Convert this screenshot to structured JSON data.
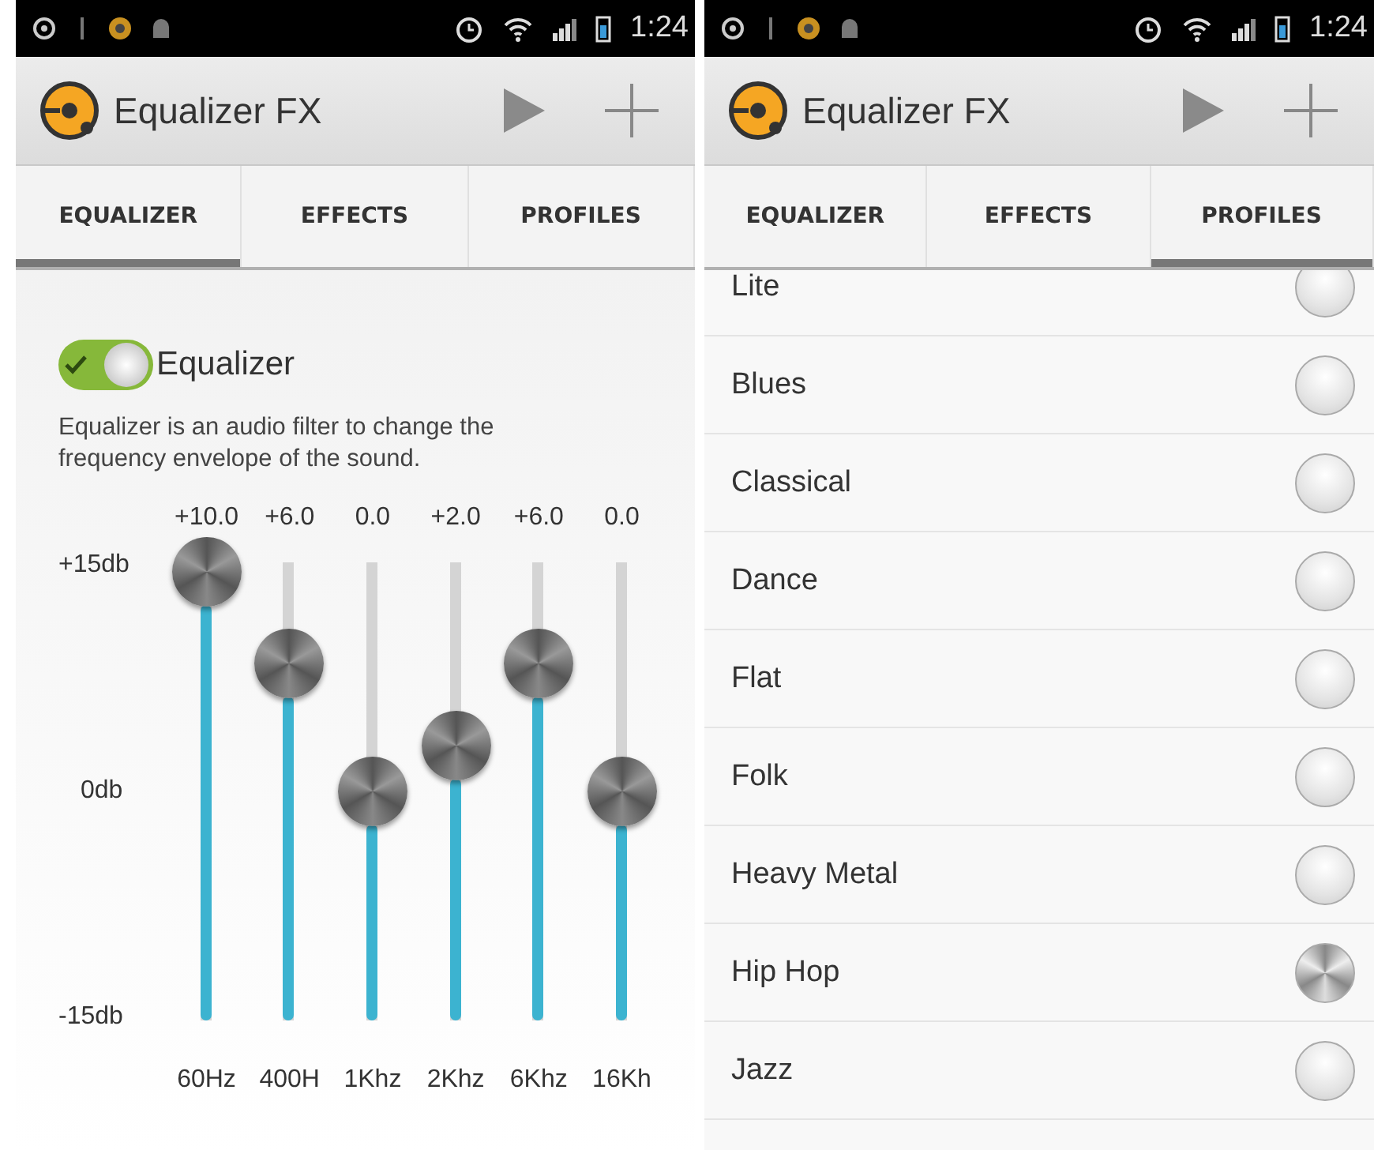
{
  "screens": [
    {
      "status_bar": {
        "time": "1:24"
      },
      "app_bar": {
        "title": "Equalizer FX"
      },
      "tabs": [
        {
          "label": "EQUALIZER",
          "selected": true
        },
        {
          "label": "EFFECTS",
          "selected": false
        },
        {
          "label": "PROFILES",
          "selected": false
        }
      ],
      "content": {
        "kind": "equalizer",
        "toggle": {
          "label": "Equalizer",
          "on": true
        },
        "description": "Equalizer is an audio filter to change the frequency envelope of the sound.",
        "scale": [
          "+15db",
          "0db",
          "-15db"
        ],
        "bands": [
          {
            "value": "+10.0",
            "frequency": "60Hz",
            "level": 0.98
          },
          {
            "value": "+6.0",
            "frequency": "400H",
            "level": 0.78
          },
          {
            "value": "0.0",
            "frequency": "1Khz",
            "level": 0.5
          },
          {
            "value": "+2.0",
            "frequency": "2Khz",
            "level": 0.6
          },
          {
            "value": "+6.0",
            "frequency": "6Khz",
            "level": 0.78
          },
          {
            "value": "0.0",
            "frequency": "16Kh",
            "level": 0.5
          }
        ]
      }
    },
    {
      "status_bar": {
        "time": "1:24"
      },
      "app_bar": {
        "title": "Equalizer FX"
      },
      "tabs": [
        {
          "label": "EQUALIZER",
          "selected": false
        },
        {
          "label": "EFFECTS",
          "selected": false
        },
        {
          "label": "PROFILES",
          "selected": true
        }
      ],
      "content": {
        "kind": "profiles",
        "profiles": [
          {
            "name": "Lite",
            "selected": false
          },
          {
            "name": "Blues",
            "selected": false
          },
          {
            "name": "Classical",
            "selected": false
          },
          {
            "name": "Dance",
            "selected": false
          },
          {
            "name": "Flat",
            "selected": false
          },
          {
            "name": "Folk",
            "selected": false
          },
          {
            "name": "Heavy Metal",
            "selected": false
          },
          {
            "name": "Hip Hop",
            "selected": true
          },
          {
            "name": "Jazz",
            "selected": false
          }
        ]
      }
    }
  ]
}
